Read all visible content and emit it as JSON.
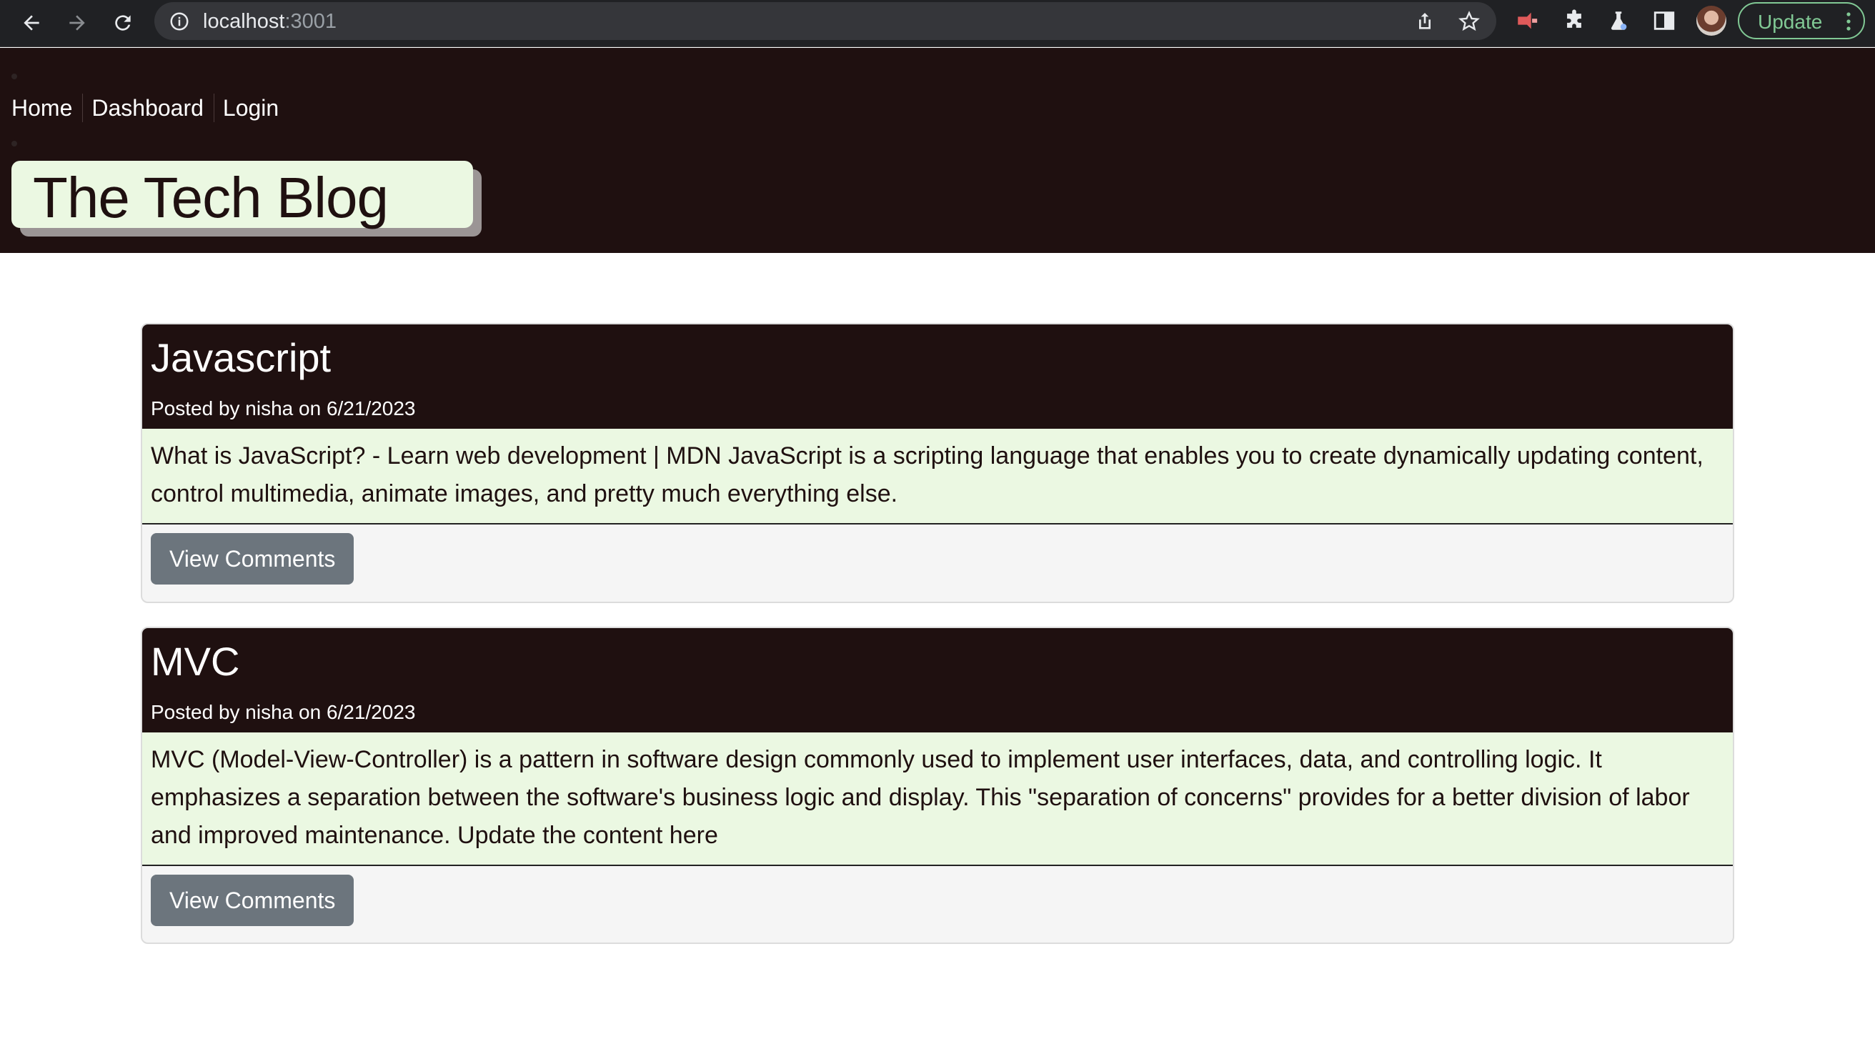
{
  "browser": {
    "url_host": "localhost",
    "url_port": ":3001",
    "update_label": "Update"
  },
  "site": {
    "nav": [
      "Home",
      "Dashboard",
      "Login"
    ],
    "title": "The Tech Blog"
  },
  "posts": [
    {
      "title": "Javascript",
      "meta": "Posted by nisha on 6/21/2023",
      "body": "What is JavaScript? - Learn web development | MDN JavaScript is a scripting language that enables you to create dynamically updating content, control multimedia, animate images, and pretty much everything else.",
      "button": "View Comments"
    },
    {
      "title": "MVC",
      "meta": "Posted by nisha on 6/21/2023",
      "body": "MVC (Model-View-Controller) is a pattern in software design commonly used to implement user interfaces, data, and controlling logic. It emphasizes a separation between the software's business logic and display. This \"separation of concerns\" provides for a better division of labor and improved maintenance. Update the content here",
      "button": "View Comments"
    }
  ],
  "colors": {
    "header_bg": "#1f1010",
    "logo_bg": "#ebf8e2",
    "body_bg": "#ebf8e2",
    "button_bg": "#6c757d",
    "update_green": "#81c995"
  }
}
